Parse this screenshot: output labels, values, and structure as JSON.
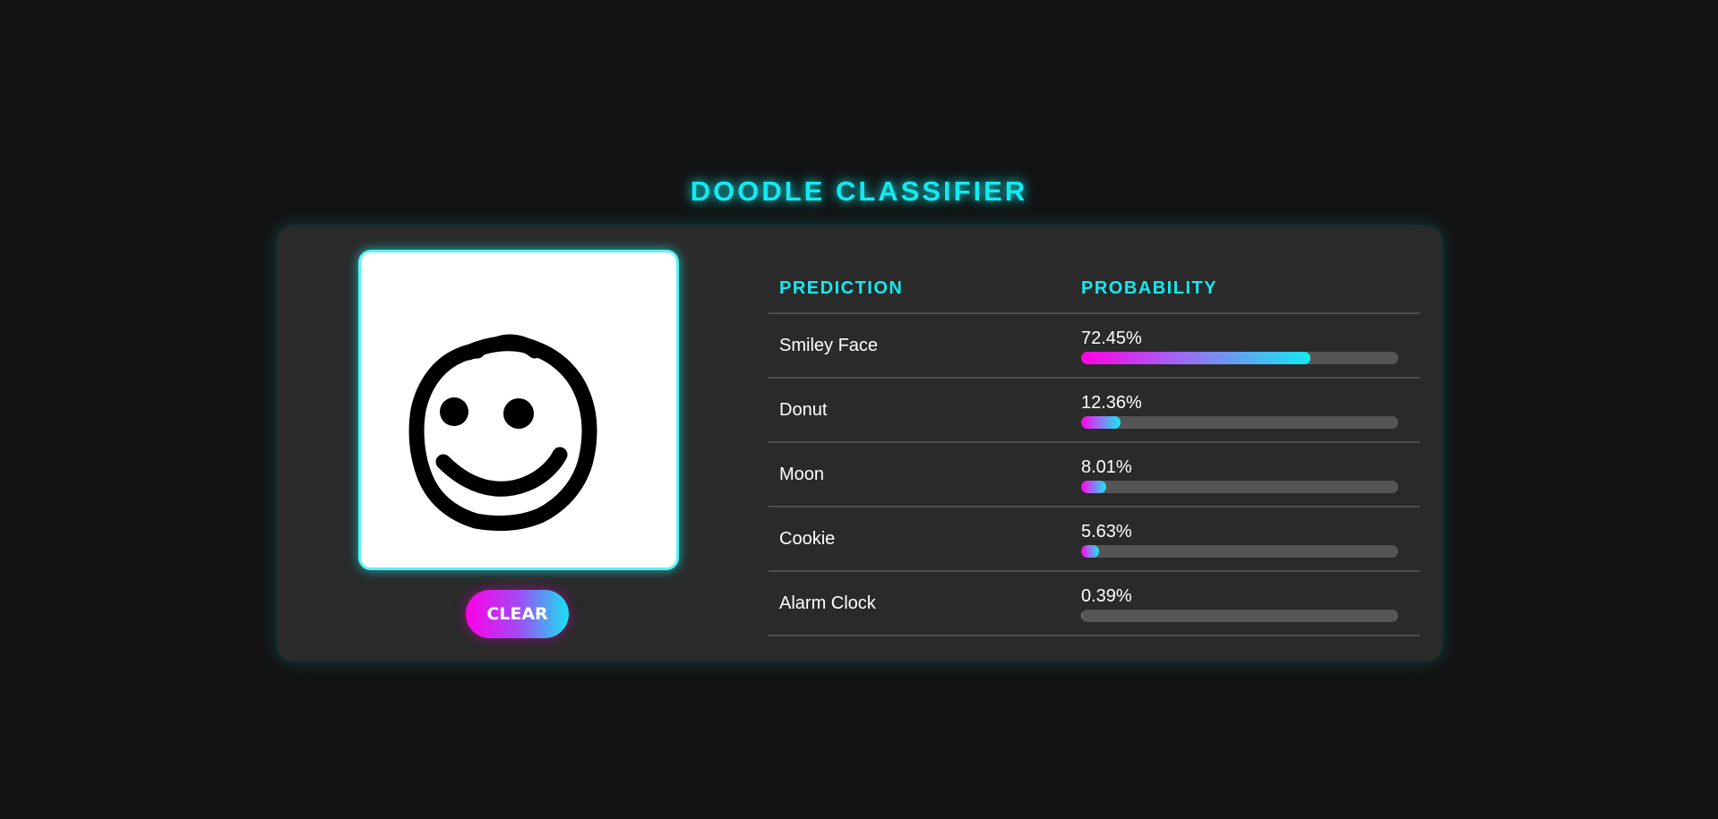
{
  "app": {
    "title": "DOODLE CLASSIFIER"
  },
  "controls": {
    "clear_label": "CLEAR"
  },
  "canvas": {
    "drawing": "smiley-face-doodle"
  },
  "results": {
    "headers": {
      "prediction": "PREDICTION",
      "probability": "PROBABILITY"
    },
    "rows": [
      {
        "label": "Smiley Face",
        "probability_text": "72.45%",
        "probability": 72.45
      },
      {
        "label": "Donut",
        "probability_text": "12.36%",
        "probability": 12.36
      },
      {
        "label": "Moon",
        "probability_text": "8.01%",
        "probability": 8.01
      },
      {
        "label": "Cookie",
        "probability_text": "5.63%",
        "probability": 5.63
      },
      {
        "label": "Alarm Clock",
        "probability_text": "0.39%",
        "probability": 0.39
      }
    ]
  },
  "colors": {
    "accent_cyan": "#13eaf0",
    "accent_magenta": "#ff00e6",
    "panel_bg": "#2a2a2a",
    "page_bg": "#131313",
    "bar_track": "#555555"
  }
}
